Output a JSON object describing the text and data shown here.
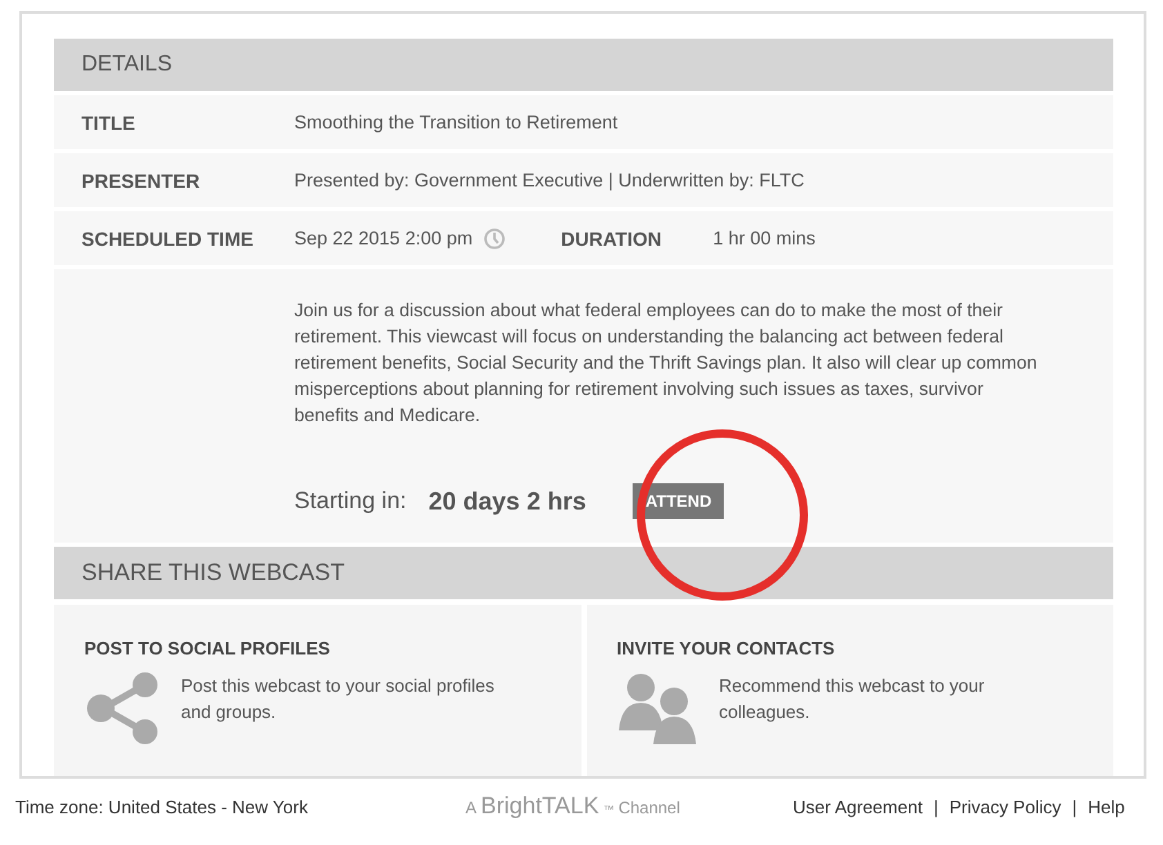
{
  "details": {
    "heading": "DETAILS",
    "rows": [
      {
        "label": "TITLE",
        "value": "Smoothing the Transition to Retirement"
      },
      {
        "label": "PRESENTER",
        "value": "Presented by: Government Executive | Underwritten by: FLTC"
      }
    ],
    "schedule": {
      "label": "SCHEDULED TIME",
      "value": "Sep 22 2015 2:00 pm",
      "duration_label": "DURATION",
      "duration_value": "1 hr 00 mins"
    },
    "description": "Join us for a discussion about what federal employees can do to make the most of their retirement. This viewcast will focus on understanding the balancing act between federal retirement benefits, Social Security and the Thrift Savings plan. It also will clear up common misperceptions about planning for retirement involving such issues as taxes, survivor benefits and Medicare.",
    "countdown_label": "Starting in:",
    "countdown_value": "20 days 2 hrs",
    "attend_button": "ATTEND"
  },
  "share": {
    "heading": "SHARE THIS WEBCAST",
    "cards": [
      {
        "kind": "share",
        "title": "POST TO SOCIAL PROFILES",
        "text": "Post this webcast to your social profiles and groups."
      },
      {
        "kind": "contacts",
        "title": "INVITE YOUR CONTACTS",
        "text": "Recommend this webcast to your colleagues."
      }
    ]
  },
  "footer": {
    "timezone": "Time zone: United States - New York",
    "brand": {
      "prefix": "A",
      "name": "BrightTALK",
      "mark": "™",
      "suffix": "Channel"
    },
    "links": [
      "User Agreement",
      "Privacy Policy",
      "Help"
    ],
    "separator": "|"
  }
}
